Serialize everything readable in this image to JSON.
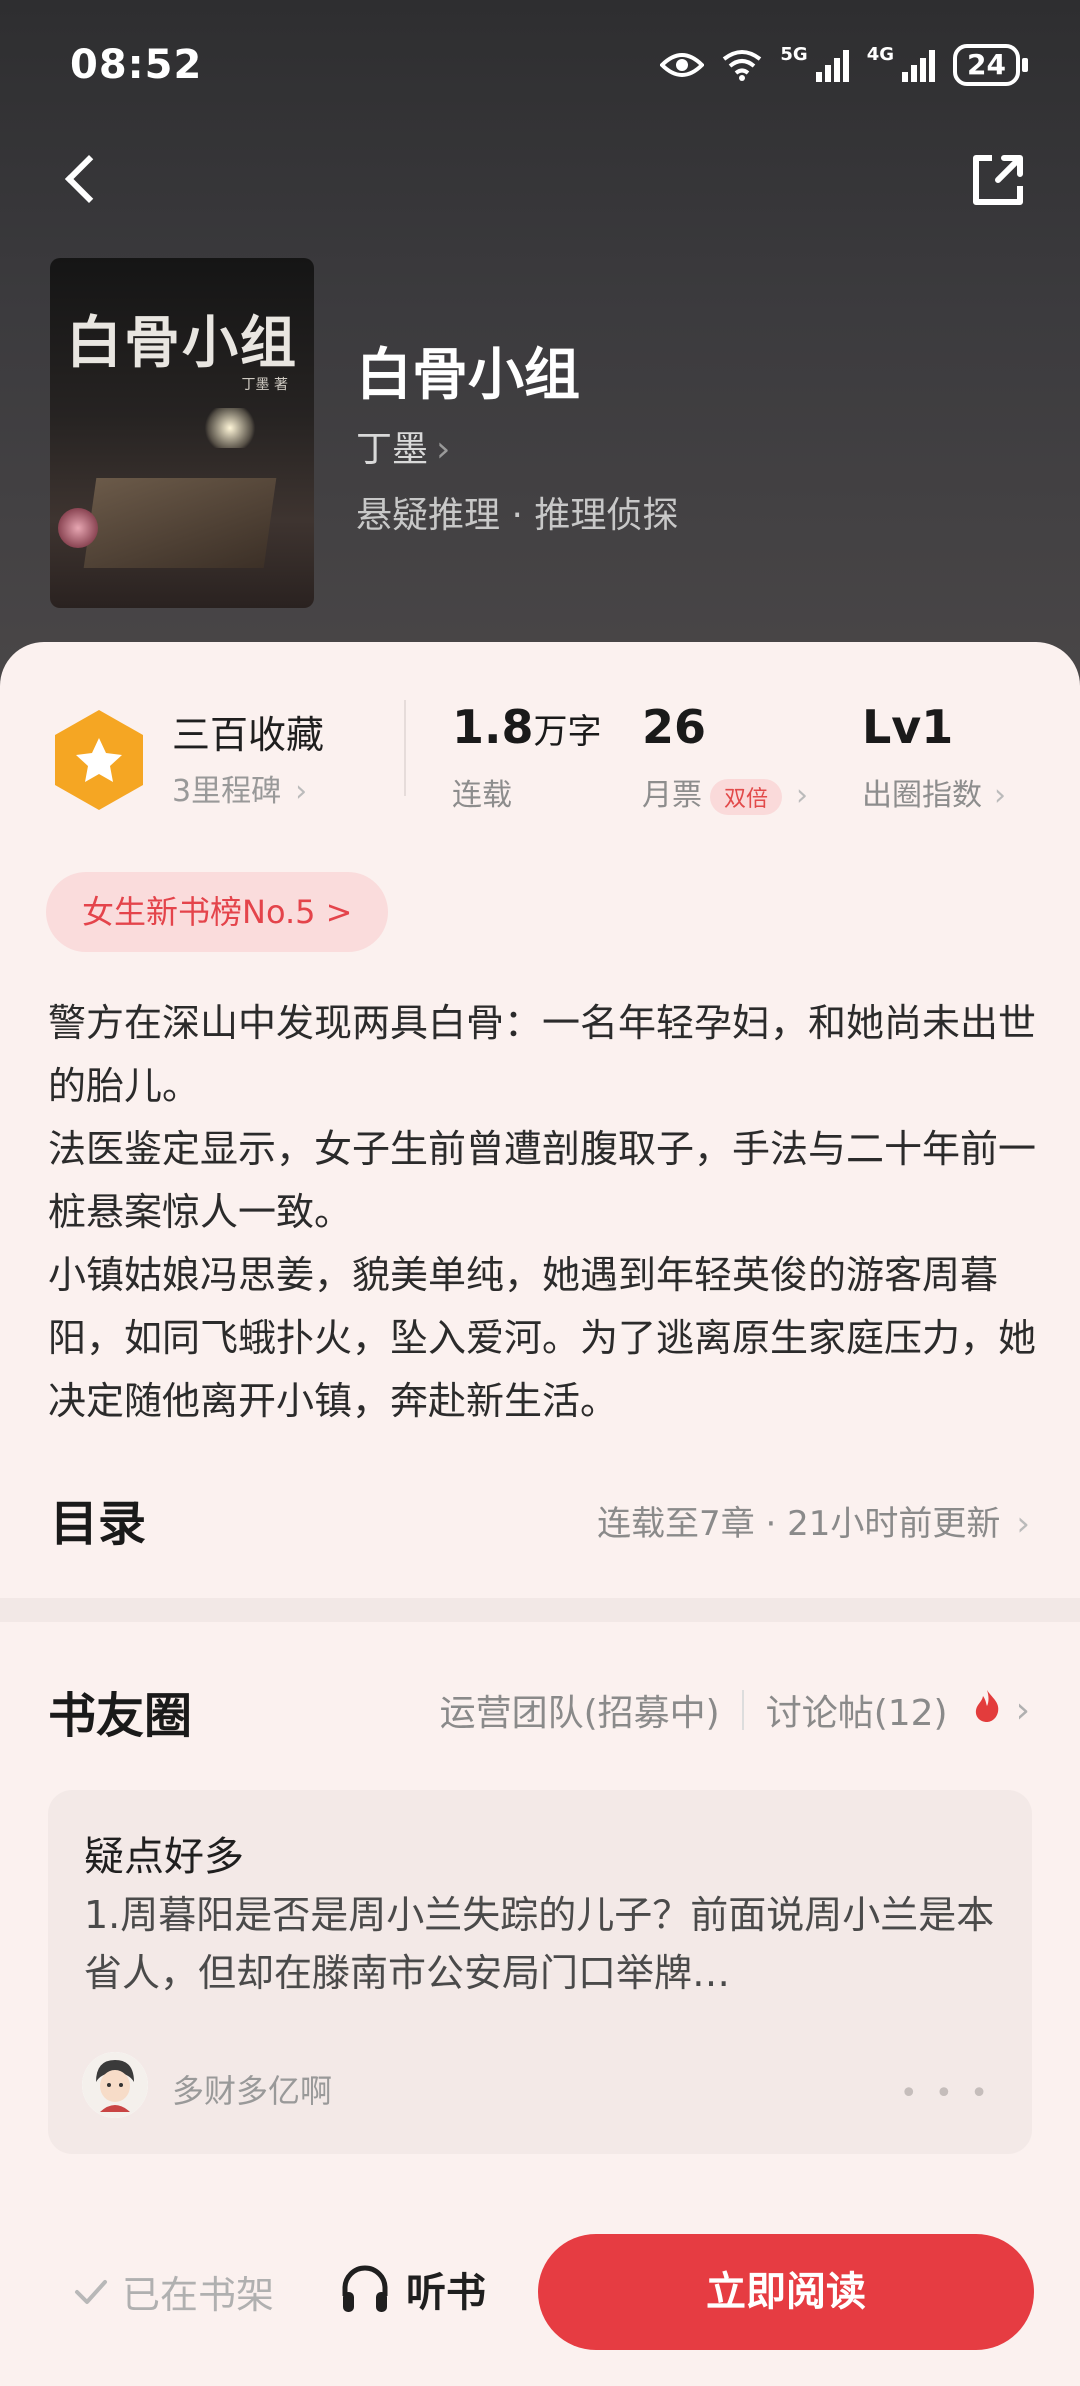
{
  "status_bar": {
    "time": "08:52",
    "net1": "5G",
    "net2": "4G",
    "battery": "24"
  },
  "book": {
    "title": "白骨小组",
    "author": "丁墨",
    "category": "悬疑推理 · 推理侦探",
    "cover_title": "白骨小组",
    "cover_author": "丁墨 著"
  },
  "stats": {
    "collection_label": "三百收藏",
    "milestone": "3里程碑",
    "word_count": "1.8",
    "word_unit": "万字",
    "word_status": "连载",
    "tickets": "26",
    "tickets_label": "月票",
    "tickets_badge": "双倍",
    "level": "Lv1",
    "level_label": "出圈指数"
  },
  "rank_badge": "女生新书榜No.5 >",
  "description": [
    "警方在深山中发现两具白骨：一名年轻孕妇，和她尚未出世的胎儿。",
    "法医鉴定显示，女子生前曾遭剖腹取子，手法与二十年前一桩悬案惊人一致。",
    "小镇姑娘冯思姜，貌美单纯，她遇到年轻英俊的游客周暮阳，如同飞蛾扑火，坠入爱河。为了逃离原生家庭压力，她决定随他离开小镇，奔赴新生活。"
  ],
  "toc": {
    "title": "目录",
    "meta": "连载至7章 · 21小时前更新"
  },
  "circle": {
    "title": "书友圈",
    "team": "运营团队(招募中)",
    "posts": "讨论帖(12)",
    "post_title": "疑点好多",
    "post_body": "1.周暮阳是否是周小兰失踪的儿子？前面说周小兰是本省人，但却在滕南市公安局门口举牌…",
    "post_user": "多财多亿啊"
  },
  "bottom": {
    "shelf": "已在书架",
    "listen": "听书",
    "read": "立即阅读"
  },
  "colors": {
    "accent": "#e63c42",
    "badge": "#f5a623",
    "sheet_bg": "#fbf1ef"
  }
}
